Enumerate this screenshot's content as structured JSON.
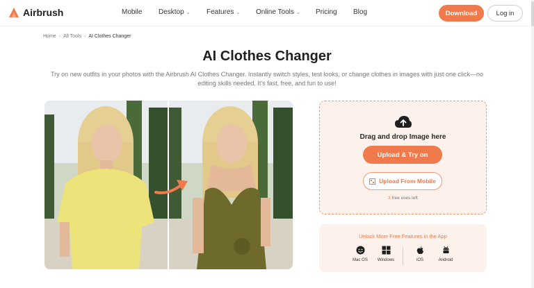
{
  "brand": {
    "name": "Airbrush",
    "accent": "#f07a4b"
  },
  "nav": {
    "links": [
      {
        "label": "Mobile",
        "has_dropdown": false
      },
      {
        "label": "Desktop",
        "has_dropdown": true
      },
      {
        "label": "Features",
        "has_dropdown": true
      },
      {
        "label": "Online Tools",
        "has_dropdown": true
      },
      {
        "label": "Pricing",
        "has_dropdown": false
      },
      {
        "label": "Blog",
        "has_dropdown": false
      }
    ],
    "download_label": "Download",
    "login_label": "Log in"
  },
  "breadcrumb": [
    "Home",
    "All Tools",
    "AI Clothes Changer"
  ],
  "page": {
    "title": "AI Clothes Changer",
    "subtitle": "Try on new outfits in your photos with the Airbrush AI Clothes Changer. Instantly switch styles, test looks, or change clothes in images with just one click—no editing skills needed. It's fast, free, and fun to use!"
  },
  "upload": {
    "drag_text": "Drag and drop Image here",
    "upload_button": "Upload & Try on",
    "mobile_button": "Upload From Mobile",
    "uses_count": "3",
    "uses_suffix": "free uses left"
  },
  "app_panel": {
    "title": "Unlock More Free Features in the App",
    "platforms": [
      {
        "icon": "macos-icon",
        "label": "Mac OS"
      },
      {
        "icon": "windows-icon",
        "label": "Windows"
      },
      {
        "icon": "apple-icon",
        "label": "iOS"
      },
      {
        "icon": "android-icon",
        "label": "Android"
      }
    ]
  },
  "images": {
    "before": "woman in yellow t-shirt",
    "after": "woman in olive satin dress"
  }
}
